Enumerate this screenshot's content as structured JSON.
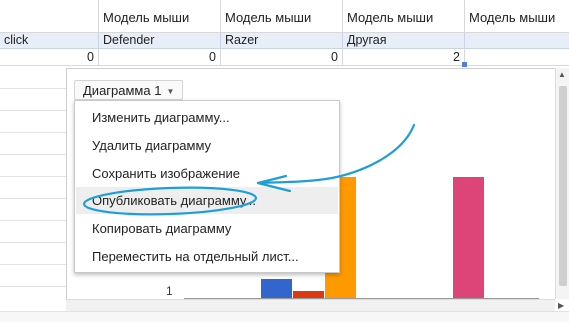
{
  "grid": {
    "header_row": [
      "",
      "Модель мыши",
      "Модель мыши",
      "Модель мыши",
      "Модель мыши"
    ],
    "name_row": [
      "click",
      "Defender",
      "Razer",
      "Другая",
      ""
    ],
    "value_row": [
      "0",
      "0",
      "0",
      "2",
      ""
    ]
  },
  "chart": {
    "button_label": "Диаграмма 1",
    "y_tick": "1"
  },
  "menu": {
    "items": [
      "Изменить диаграмму...",
      "Удалить диаграмму",
      "Сохранить изображение",
      "Опубликовать диаграмму...",
      "Копировать диаграмму",
      "Переместить на отдельный лист..."
    ],
    "highlighted_index": 3
  },
  "colors": {
    "annotation": "#1e9fd6",
    "bar_orange": "#ff9900",
    "bar_pink": "#dd4477",
    "bar_blue": "#3366cc",
    "bar_red": "#dc3912",
    "selection_header": "#e8eef7"
  }
}
